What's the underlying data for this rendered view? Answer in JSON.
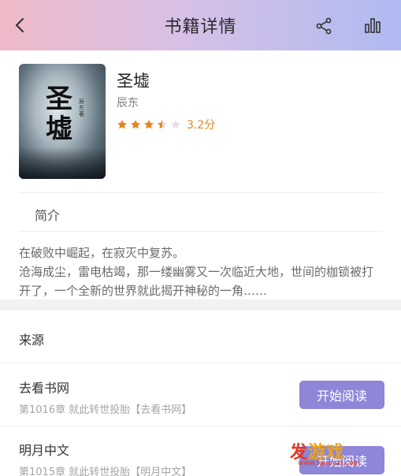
{
  "header": {
    "title": "书籍详情",
    "back_icon": "chevron-left-icon",
    "share_icon": "share-icon",
    "rank_icon": "bar-chart-icon"
  },
  "book": {
    "cover_title": "圣墟",
    "cover_subtitle": "辰东著",
    "title": "圣墟",
    "author": "辰东",
    "rating": 3.2,
    "rating_text": "3.2分",
    "star_color": "#e5861a"
  },
  "intro": {
    "label": "简介",
    "text": "在破败中崛起，在寂灭中复苏。\n 沧海成尘，雷电枯竭，那一缕幽雾又一次临近大地，世间的枷锁被打开了，一个全新的世界就此揭开神秘的一角……"
  },
  "sources": {
    "title": "来源",
    "items": [
      {
        "name": "去看书网",
        "chapter": "第1016章 就此转世投胎【去看书网】",
        "button": "开始阅读"
      },
      {
        "name": "明月中文",
        "chapter": "第1015章 就此转世投胎【明月中文】",
        "button": "开始阅读"
      }
    ]
  },
  "watermark": {
    "main_a": "发",
    "main_b": "游戏",
    "url": "www.fayouxi.com"
  },
  "colors": {
    "button": "#8e86d8",
    "accent": "#e5861a"
  }
}
